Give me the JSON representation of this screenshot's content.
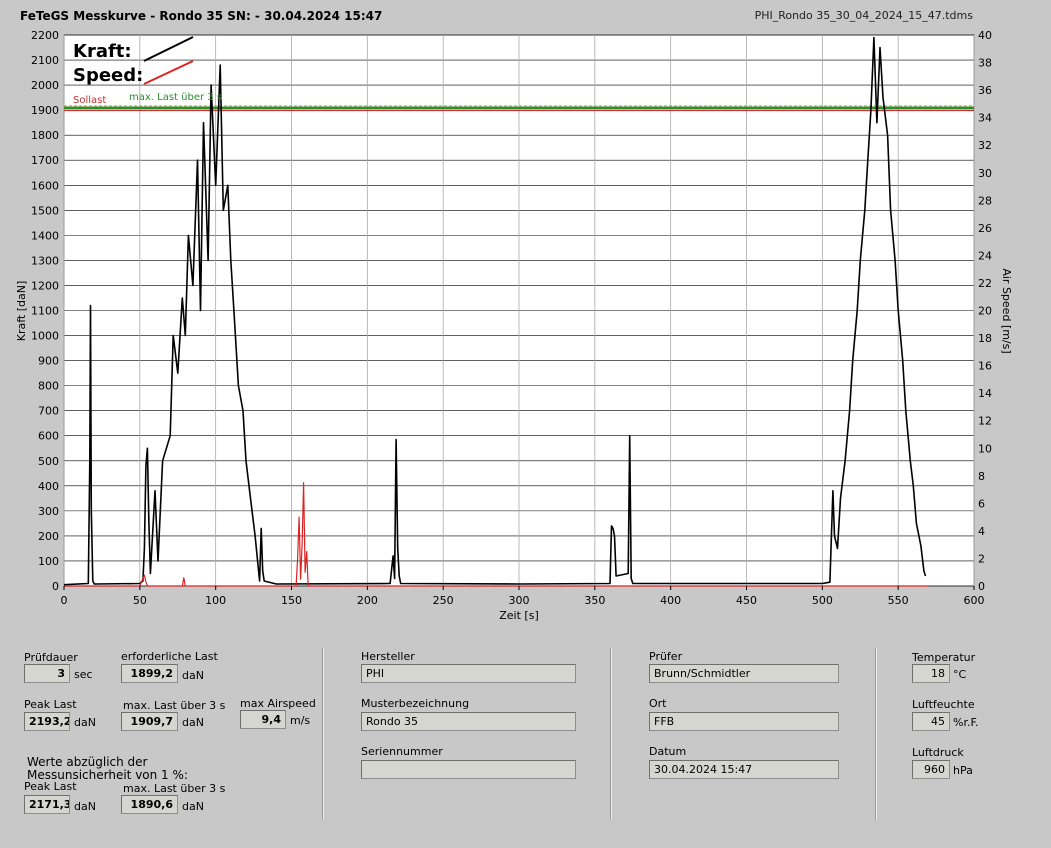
{
  "header": {
    "title": "FeTeGS Messkurve - Rondo 35  SN:  - 30.04.2024 15:47",
    "filename": "PHI_Rondo 35_30_04_2024_15_47.tdms"
  },
  "chart_data": {
    "type": "line",
    "xlabel": "Zeit [s]",
    "ylabel": "Kraft [daN]",
    "y2label": "Air Speed [m/s]",
    "xlim": [
      0,
      600
    ],
    "ylim": [
      0,
      2200
    ],
    "y2lim": [
      0,
      40
    ],
    "xticks": [
      0,
      50,
      100,
      150,
      200,
      250,
      300,
      350,
      400,
      450,
      500,
      550,
      600
    ],
    "yticks": [
      0,
      100,
      200,
      300,
      400,
      500,
      600,
      700,
      800,
      900,
      1000,
      1100,
      1200,
      1300,
      1400,
      1500,
      1600,
      1700,
      1800,
      1900,
      2000,
      2100,
      2200
    ],
    "y2ticks": [
      0,
      2,
      4,
      6,
      8,
      10,
      12,
      14,
      16,
      18,
      20,
      22,
      24,
      26,
      28,
      30,
      32,
      34,
      36,
      38,
      40
    ],
    "grid": true,
    "legend": {
      "position": "top-left",
      "entries": [
        "Kraft:",
        "Speed:"
      ]
    },
    "colors": {
      "kraft": "#000000",
      "speed": "#dd2222",
      "sollast": "#c83232",
      "maxlast": "#2e8b2e"
    },
    "reference_lines": [
      {
        "name": "Sollast",
        "value": 1899.2
      },
      {
        "name": "max. Last über 3 s",
        "value": 1909.7
      }
    ],
    "series": [
      {
        "name": "Kraft",
        "axis": "left",
        "x": [
          0,
          16,
          17,
          17.5,
          18,
          19,
          20,
          50,
          52,
          53,
          54,
          55,
          56,
          57,
          60,
          62,
          65,
          70,
          72,
          75,
          78,
          80,
          82,
          85,
          88,
          90,
          92,
          95,
          97,
          100,
          103,
          105,
          108,
          110,
          112,
          115,
          118,
          120,
          123,
          126,
          128,
          129,
          130,
          131,
          132,
          140,
          215,
          217,
          218,
          219,
          220,
          221,
          222,
          300,
          360,
          361,
          362,
          363,
          364,
          372,
          373,
          374,
          375,
          500,
          505,
          507,
          508,
          510,
          512,
          515,
          518,
          520,
          523,
          525,
          528,
          530,
          532,
          534,
          536,
          538,
          540,
          543,
          545,
          548,
          550,
          553,
          555,
          558,
          560,
          562,
          565,
          567,
          568
        ],
        "y": [
          5,
          10,
          500,
          1120,
          300,
          20,
          8,
          10,
          20,
          150,
          480,
          550,
          250,
          50,
          380,
          100,
          500,
          600,
          1000,
          850,
          1150,
          1000,
          1400,
          1200,
          1700,
          1100,
          1850,
          1300,
          2000,
          1600,
          2080,
          1500,
          1600,
          1300,
          1100,
          800,
          700,
          500,
          350,
          200,
          80,
          20,
          230,
          60,
          20,
          8,
          10,
          120,
          30,
          585,
          150,
          40,
          10,
          8,
          10,
          240,
          230,
          200,
          40,
          50,
          600,
          30,
          10,
          10,
          15,
          380,
          200,
          150,
          350,
          500,
          700,
          900,
          1100,
          1300,
          1500,
          1700,
          1900,
          2190,
          1850,
          2150,
          1950,
          1800,
          1500,
          1300,
          1100,
          900,
          700,
          500,
          400,
          250,
          160,
          60,
          40
        ]
      },
      {
        "name": "Speed",
        "axis": "right",
        "x": [
          0,
          50,
          53,
          54,
          55,
          56,
          57,
          78,
          79,
          80,
          81,
          153,
          154,
          155,
          156,
          157,
          158,
          159,
          160,
          161,
          570
        ],
        "y": [
          0,
          0,
          0.8,
          0.3,
          0,
          0,
          0,
          0,
          0.6,
          0,
          0,
          0,
          2,
          5,
          0.5,
          3,
          7.5,
          1,
          2.5,
          0,
          0
        ]
      }
    ]
  },
  "panel": {
    "pruefdauer": {
      "label": "Prüfdauer",
      "value": "3",
      "unit": "sec"
    },
    "erforderliche_last": {
      "label": "erforderliche Last",
      "value": "1899,2",
      "unit": "daN"
    },
    "peak_last": {
      "label": "Peak Last",
      "value": "2193,2",
      "unit": "daN"
    },
    "max_last": {
      "label": "max. Last über  3 s",
      "value": "1909,7",
      "unit": "daN"
    },
    "max_airspeed": {
      "label": "max Airspeed",
      "value": "9,4",
      "unit": "m/s"
    },
    "abzug": {
      "line1": "Werte abzüglich der",
      "line2": "Messunsicherheit von 1  %:"
    },
    "peak_last_2": {
      "label": "Peak Last",
      "value": "2171,3",
      "unit": "daN"
    },
    "max_last_2": {
      "label": "max. Last über  3 s",
      "value": "1890,6",
      "unit": "daN"
    },
    "hersteller": {
      "label": "Hersteller",
      "value": "PHI"
    },
    "muster": {
      "label": "Musterbezeichnung",
      "value": "Rondo 35"
    },
    "serien": {
      "label": "Seriennummer",
      "value": ""
    },
    "pruefer": {
      "label": "Prüfer",
      "value": "Brunn/Schmidtler"
    },
    "ort": {
      "label": "Ort",
      "value": "FFB"
    },
    "datum": {
      "label": "Datum",
      "value": "30.04.2024 15:47"
    },
    "temperatur": {
      "label": "Temperatur",
      "value": "18",
      "unit": "°C"
    },
    "luftfeuchte": {
      "label": "Luftfeuchte",
      "value": "45",
      "unit": "%r.F."
    },
    "luftdruck": {
      "label": "Luftdruck",
      "value": "960",
      "unit": "hPa"
    }
  }
}
